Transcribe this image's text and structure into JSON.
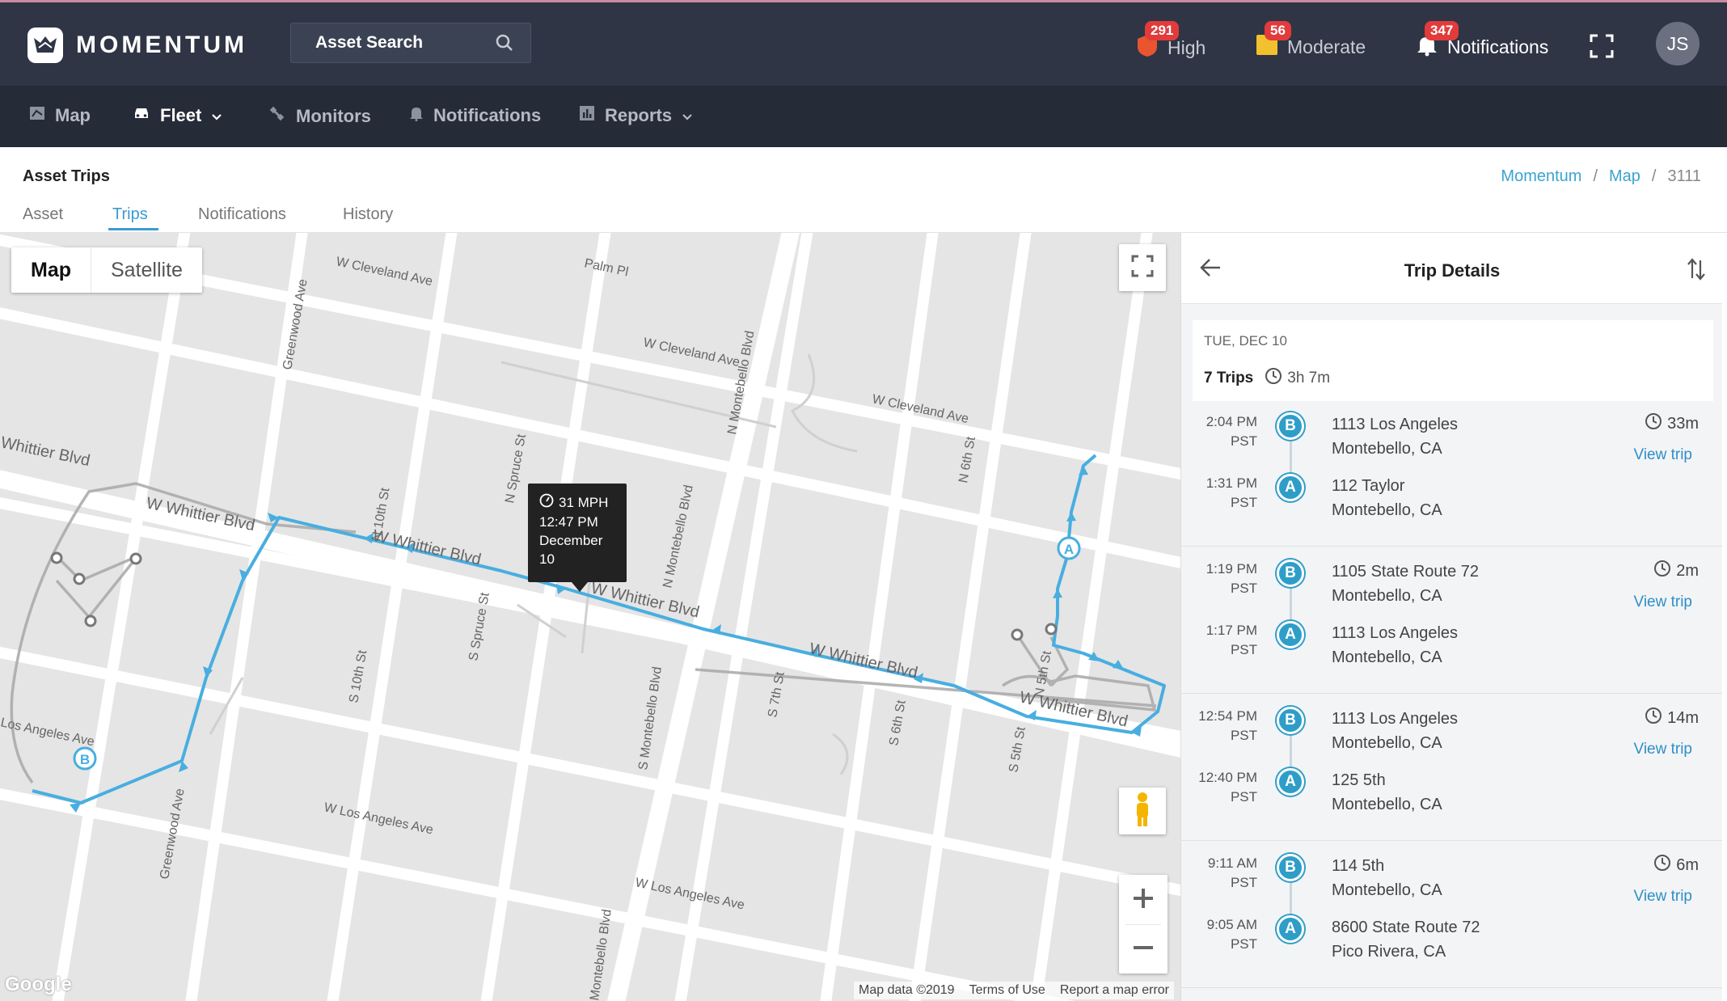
{
  "app": {
    "name": "MOMENTUM"
  },
  "search": {
    "label": "Asset Search"
  },
  "alerts": [
    {
      "label": "High",
      "count": "291",
      "color": "#e8552e"
    },
    {
      "label": "Moderate",
      "count": "56",
      "color": "#f2c12e"
    },
    {
      "label": "Notifications",
      "count": "347",
      "color": "#ffffff"
    }
  ],
  "user": {
    "initials": "JS"
  },
  "nav": [
    {
      "label": "Map"
    },
    {
      "label": "Fleet",
      "active": true
    },
    {
      "label": "Monitors"
    },
    {
      "label": "Notifications"
    },
    {
      "label": "Reports"
    }
  ],
  "page": {
    "title": "Asset Trips"
  },
  "breadcrumb": [
    "Momentum",
    "Map",
    "3111"
  ],
  "tabs": [
    "Asset",
    "Trips",
    "Notifications",
    "History"
  ],
  "map": {
    "type_map": "Map",
    "type_satellite": "Satellite",
    "tooltip": {
      "speed": "31 MPH",
      "time": "12:47 PM",
      "date": "December 10"
    },
    "footer": {
      "data": "Map data ©2019",
      "terms": "Terms of Use",
      "report": "Report a map error"
    },
    "streets": [
      "W Cleveland Ave",
      "Palm Pl",
      "W Cleveland Ave",
      "W Cleveland Ave",
      "Greenwood Ave",
      "N Montebello Blvd",
      "N Montebello Blvd",
      "W Whittier Blvd",
      "W Whittier Blvd",
      "W Whittier Blvd",
      "W Whittier Blvd",
      "W Whittier Blvd",
      "S Montebello Blvd",
      "W Los Angeles Ave",
      "W Los Angeles Ave",
      "N Spruce St",
      "S Spruce St",
      "N 10th St",
      "S 10th St",
      "N 6th St",
      "S 6th St",
      "S 7th St",
      "N 5th St",
      "S 5th St",
      "Greenwood Ave",
      "Whittier Blvd",
      "Montebello Blvd",
      "Los Angeles Ave"
    ],
    "marker_a": "A",
    "marker_b": "B",
    "google": "Google"
  },
  "panel": {
    "title": "Trip Details",
    "day": "TUE, DEC 10",
    "trips_count": "7 Trips",
    "total_duration": "3h 7m",
    "view_trip": "View trip",
    "trips": [
      {
        "duration": "33m",
        "end": {
          "time": "2:04 PM",
          "tz": "PST",
          "line1": "1113 Los Angeles",
          "line2": "Montebello, CA"
        },
        "start": {
          "time": "1:31 PM",
          "tz": "PST",
          "line1": "112 Taylor",
          "line2": "Montebello, CA"
        }
      },
      {
        "duration": "2m",
        "end": {
          "time": "1:19 PM",
          "tz": "PST",
          "line1": "1105 State Route 72",
          "line2": "Montebello, CA"
        },
        "start": {
          "time": "1:17 PM",
          "tz": "PST",
          "line1": "1113 Los Angeles",
          "line2": "Montebello, CA"
        }
      },
      {
        "duration": "14m",
        "end": {
          "time": "12:54 PM",
          "tz": "PST",
          "line1": "1113 Los Angeles",
          "line2": "Montebello, CA"
        },
        "start": {
          "time": "12:40 PM",
          "tz": "PST",
          "line1": "125 5th",
          "line2": "Montebello, CA"
        }
      },
      {
        "duration": "6m",
        "end": {
          "time": "9:11 AM",
          "tz": "PST",
          "line1": "114 5th",
          "line2": "Montebello, CA"
        },
        "start": {
          "time": "9:05 AM",
          "tz": "PST",
          "line1": "8600 State Route 72",
          "line2": "Pico Rivera, CA"
        }
      }
    ]
  }
}
